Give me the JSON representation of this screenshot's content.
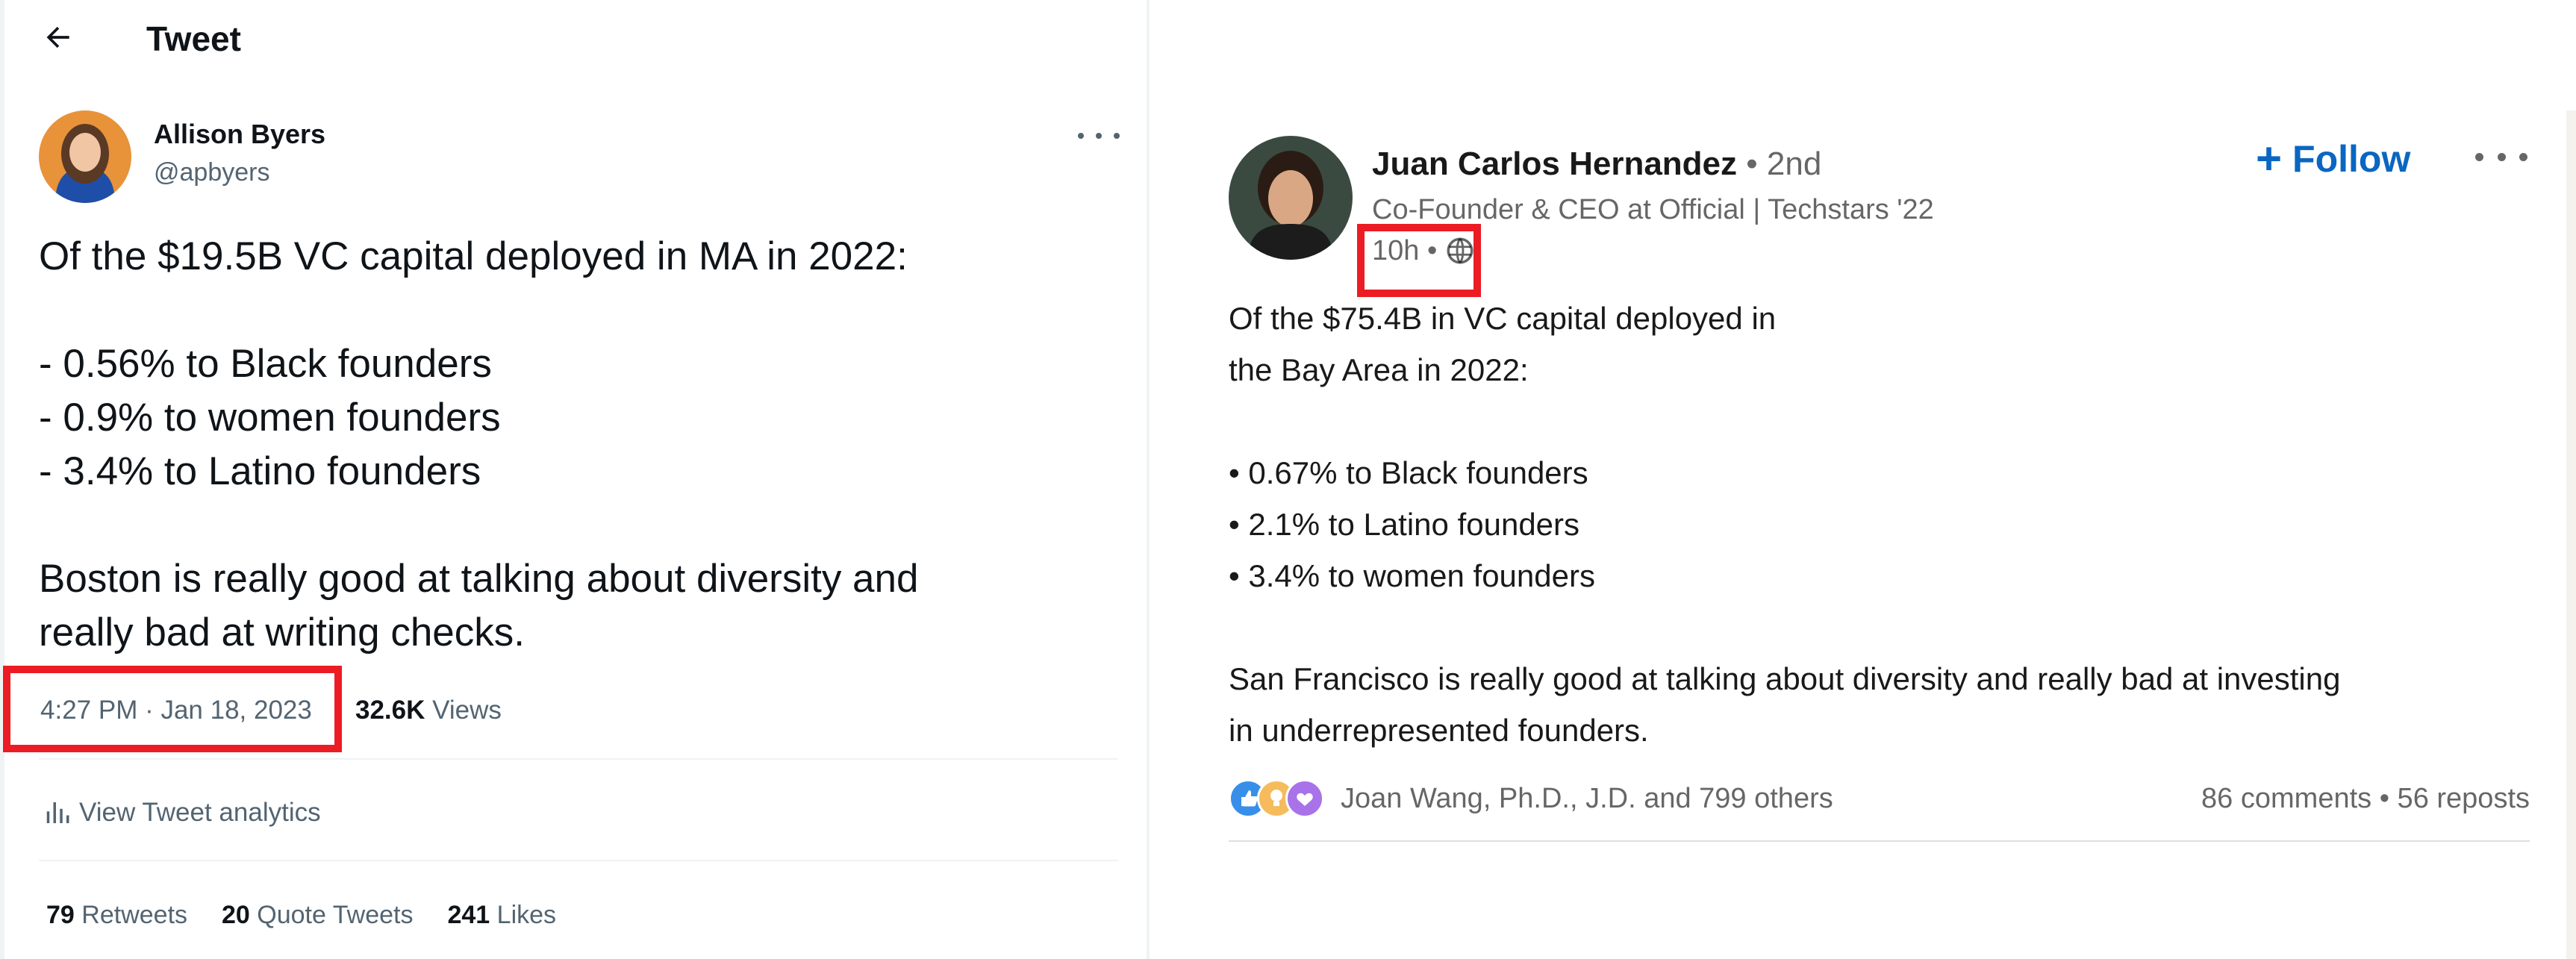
{
  "tweet": {
    "header_title": "Tweet",
    "author": {
      "name": "Allison Byers",
      "handle": "@apbyers"
    },
    "lines": [
      "Of the $19.5B VC capital deployed in MA in 2022:",
      "",
      "- 0.56% to Black founders",
      "- 0.9% to women founders",
      "- 3.4% to Latino founders",
      "",
      "Boston is really good at talking about diversity and",
      "really bad at writing checks."
    ],
    "timestamp": "4:27 PM · Jan 18, 2023",
    "views_count": "32.6K",
    "views_label": "Views",
    "analytics_label": "View Tweet analytics",
    "stats": {
      "retweets_count": "79",
      "retweets_label": "Retweets",
      "quotes_count": "20",
      "quotes_label": "Quote Tweets",
      "likes_count": "241",
      "likes_label": "Likes"
    }
  },
  "linkedin": {
    "author": {
      "name": "Juan Carlos Hernandez",
      "degree": " • 2nd",
      "headline": "Co-Founder & CEO at Official | Techstars '22",
      "time": "10h •"
    },
    "follow_label": "Follow",
    "lines": [
      "Of the $75.4B in VC capital deployed in",
      "the Bay Area in 2022:",
      "",
      " • 0.67% to Black founders",
      " • 2.1% to Latino founders",
      " • 3.4% to women founders",
      "",
      "San Francisco is really good at talking about diversity and really bad at investing",
      "in underrepresented founders."
    ],
    "reactions_text": "Joan Wang, Ph.D., J.D. and 799 others",
    "counts_text": "86 comments • 56 reposts"
  },
  "colors": {
    "highlight": "#ec1c24",
    "linkedin_blue": "#0a66c2",
    "twitter_secondary": "#536471"
  }
}
